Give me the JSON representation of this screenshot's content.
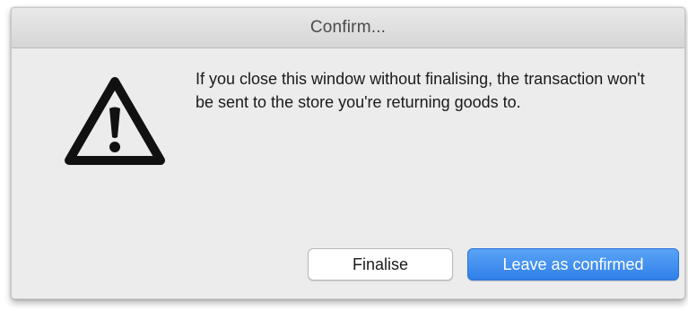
{
  "dialog": {
    "title": "Confirm...",
    "message": "If you close this window without finalising, the transaction won't be sent to the store you're returning goods to.",
    "icon": "warning-icon",
    "buttons": {
      "finalise_label": "Finalise",
      "leave_label": "Leave as confirmed"
    }
  },
  "colors": {
    "dialog_background": "#ececec",
    "titlebar_background": "#dcdcdc",
    "primary_button": "#3b8df0",
    "text": "#1a1a1a"
  }
}
